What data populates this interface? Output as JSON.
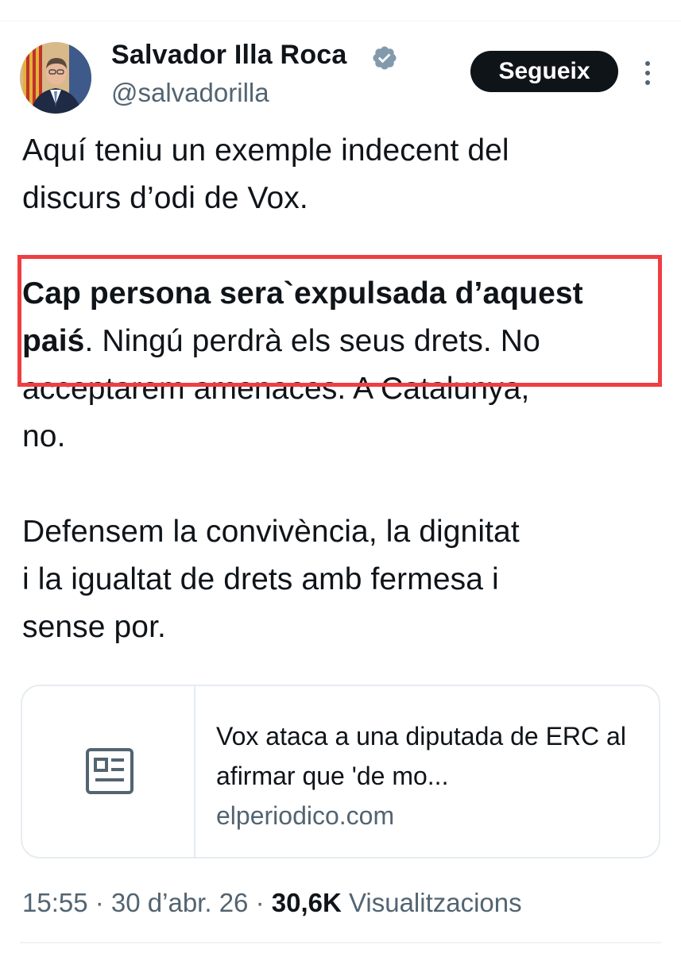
{
  "author": {
    "name": "Salvador Illa Roca",
    "handle": "@salvadorilla",
    "verified": true,
    "verified_color": "#829aab"
  },
  "follow_button": {
    "label": "Segueix"
  },
  "tweet": {
    "para1": "Aquí teniu un exemple indecent del\ndiscurs d’odi de Vox.",
    "para2_bold": "Cap persona sera`expulsada d’aquest\npaiś",
    "para2_rest": ". Ningú perdrà els seus drets. No\nacceptarem amenaces. A Catalunya,\nno.",
    "para3": "Defensem la convivència, la dignitat\ni la igualtat de drets amb fermesa i\nsense por.",
    "highlight_color": "#ef3e42"
  },
  "link_card": {
    "title": "Vox ataca a una diputada de ERC al afirmar que 'de mo...",
    "domain": "elperiodico.com"
  },
  "meta": {
    "time": "15:55",
    "separator": " · ",
    "date": "30 d’abr. 26",
    "views_count": "30,6K",
    "views_label": " Visualitzacions"
  },
  "colors": {
    "text": "#0f1419",
    "secondary": "#536471",
    "border": "#e6ecf0"
  }
}
